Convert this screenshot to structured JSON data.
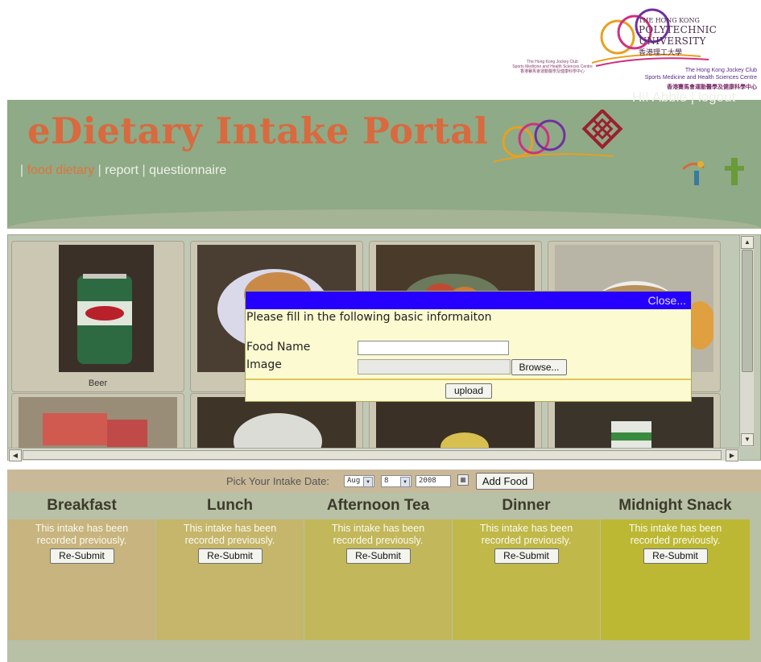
{
  "top_logo": {
    "line1": "The Hong Kong Jockey Club",
    "line2": "Sports Medicine and Health Sciences Centre",
    "line3": "香港賽馬會運動醫學及健康科學中心"
  },
  "header": {
    "title": "eDietary Intake Portal",
    "nav": [
      {
        "label": "food dietary",
        "active": true
      },
      {
        "label": "report",
        "active": false
      },
      {
        "label": "questionnaire",
        "active": false
      }
    ],
    "separator": "|",
    "polyu": {
      "line1": "THE HONG KONG",
      "line2": "POLYTECHNIC UNIVERSITY",
      "line3": "香港理工大學"
    },
    "hkjc_small": {
      "line1": "The Hong Kong Jockey Club",
      "line2": "Sports Medicine and Health Sciences Centre",
      "line3": "香港賽馬會運動醫學及健康科學中心"
    },
    "greeting": "Hi! Abbie",
    "logout": "logout"
  },
  "gallery": {
    "items": [
      {
        "label": "Beer"
      }
    ]
  },
  "modal": {
    "close_label": "Close...",
    "message": "Please fill in the following basic informaiton",
    "food_name_label": "Food Name",
    "food_name_value": "",
    "image_label": "Image",
    "browse_label": "Browse...",
    "upload_label": "upload"
  },
  "date_picker": {
    "label": "Pick Your Intake Date:",
    "month": "Aug",
    "day": "8",
    "year": "2008",
    "add_food_label": "Add Food"
  },
  "meals": [
    {
      "name": "Breakfast",
      "status_line1": "This intake has been",
      "status_line2": "recorded previously.",
      "button": "Re-Submit",
      "color": "#c8b47e"
    },
    {
      "name": "Lunch",
      "status_line1": "This intake has been",
      "status_line2": "recorded previously.",
      "button": "Re-Submit",
      "color": "#c5b66b"
    },
    {
      "name": "Afternoon Tea",
      "status_line1": "This intake has been",
      "status_line2": "recorded previously.",
      "button": "Re-Submit",
      "color": "#c2b75a"
    },
    {
      "name": "Dinner",
      "status_line1": "This intake has been",
      "status_line2": "recorded previously.",
      "button": "Re-Submit",
      "color": "#c0b848"
    },
    {
      "name": "Midnight Snack",
      "status_line1": "This intake has been",
      "status_line2": "recorded previously.",
      "button": "Re-Submit",
      "color": "#bdb833"
    }
  ],
  "colors": {
    "header_green": "#8faa86",
    "title_orange": "#d9693e",
    "modal_bar_blue": "#2600ff",
    "modal_bg": "#fbfad0"
  },
  "icons": [
    "hkjc-rings-logo",
    "polyu-logo",
    "calendar-icon",
    "scroll-up-arrow",
    "scroll-down-arrow",
    "scroll-left-arrow",
    "scroll-right-arrow"
  ]
}
